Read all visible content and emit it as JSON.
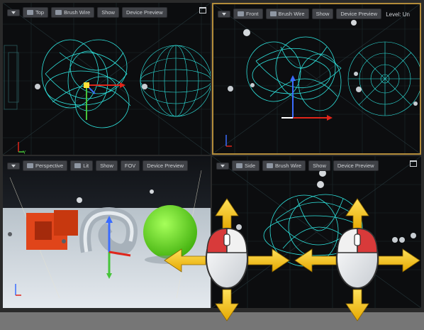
{
  "viewports": {
    "top": {
      "mode": "Top",
      "view": "Brush Wire",
      "show": "Show",
      "preview": "Device Preview"
    },
    "front": {
      "mode": "Front",
      "view": "Brush Wire",
      "show": "Show",
      "preview": "Device Preview",
      "level": "Level:  Un"
    },
    "persp": {
      "mode": "Perspective",
      "view": "Lit",
      "show": "Show",
      "fov": "FOV",
      "preview": "Device Preview"
    },
    "side": {
      "mode": "Side",
      "view": "Brush Wire",
      "show": "Show",
      "preview": "Device Preview"
    }
  },
  "colors": {
    "wire": "#2fe6e0",
    "active_border": "#b48c3a",
    "arrow": "#f5c51a",
    "mouse_button": "#d83a3a"
  },
  "icons": [
    "menu-chevron-icon",
    "viewport-type-icon",
    "view-mode-icon",
    "maximize-icon",
    "mouse-icon",
    "move-arrow-icon",
    "axis-gizmo-icon"
  ]
}
